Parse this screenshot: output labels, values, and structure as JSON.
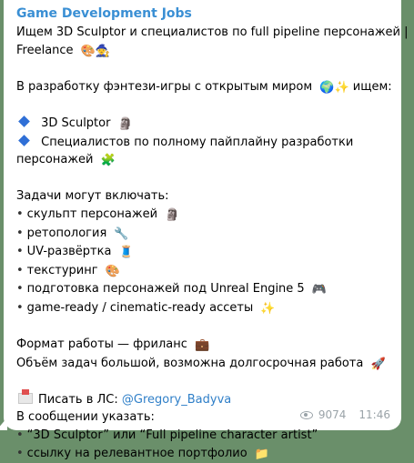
{
  "channel": {
    "name": "Game Development Jobs"
  },
  "post": {
    "title_line1": "Ищем 3D Sculptor и специалистов по full pipeline персонажей |",
    "title_line2": "Freelance",
    "title_emoji": "🎨🧙",
    "intro": "В разработку фэнтези-игры с открытым миром",
    "intro_emoji": "🌍✨",
    "intro_suffix": "ищем:",
    "roles": [
      {
        "text": "3D Sculptor",
        "emoji": "🗿"
      },
      {
        "text_line1": "Специалистов по полному пайплайну разработки",
        "text_line2": "персонажей",
        "emoji": "🧩"
      }
    ],
    "tasks_header": "Задачи могут включать:",
    "tasks": [
      {
        "text": "скульпт персонажей",
        "emoji": "🗿"
      },
      {
        "text": "ретопология",
        "emoji": "🔧"
      },
      {
        "text": "UV-развёртка",
        "emoji": "🧵"
      },
      {
        "text": "текстуринг",
        "emoji": "🎨"
      },
      {
        "text": "подготовка персонажей под Unreal Engine 5",
        "emoji": "🎮"
      },
      {
        "text": "game-ready / cinematic-ready ассеты",
        "emoji": "✨"
      }
    ],
    "format": "Формат работы — фриланс",
    "format_emoji": "💼",
    "scope": "Объём задач большой, возможна долгосрочная работа",
    "scope_emoji": "🚀",
    "contact_prefix": "Писать в ЛС:",
    "contact_handle": "@Gregory_Badyva",
    "message_header": "В сообщении указать:",
    "requirements": [
      {
        "text": "“3D Sculptor” или “Full pipeline character artist”"
      },
      {
        "text": "ссылку на релевантное портфолио",
        "emoji": "📁"
      }
    ]
  },
  "meta": {
    "views": "9074",
    "time": "11:46"
  },
  "colors": {
    "background": "#6a8f6a",
    "bubble": "#ffffff",
    "channel_name": "#3a8fd4",
    "link": "#2f7fc8",
    "meta": "#9aa3a8"
  },
  "icons": {
    "views": "eye-icon",
    "contact": "envelope-icon",
    "role_bullet": "blue-diamond-icon"
  }
}
